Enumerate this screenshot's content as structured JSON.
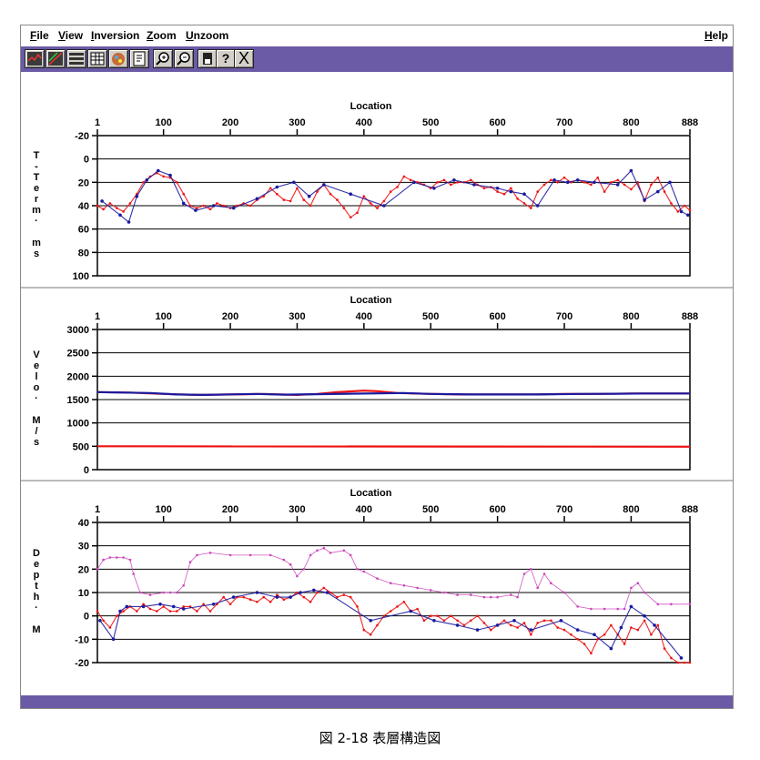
{
  "menu": {
    "file": {
      "accel": "F",
      "rest": "ile"
    },
    "view": {
      "accel": "V",
      "rest": "iew"
    },
    "inversion": {
      "accel": "I",
      "rest": "nversion"
    },
    "zoom": {
      "accel": "Z",
      "rest": "oom"
    },
    "unzoom": {
      "accel": "U",
      "rest": "nzoom"
    },
    "help": {
      "accel": "H",
      "rest": "elp"
    }
  },
  "toolbar": {
    "help_glyph": "?",
    "close_glyph": "X"
  },
  "caption": "図 2-18  表層構造図",
  "colors": {
    "accent": "#6b5aa6",
    "series_red": "#ee1111",
    "series_blue": "#1a1aa0",
    "series_magenta": "#cc44bb"
  },
  "chart_data": [
    {
      "type": "scatter",
      "xlabel": "Location",
      "ylabel_chars": [
        "T",
        "-",
        "T",
        "e",
        "r",
        "m",
        "·",
        "",
        "m",
        "s"
      ],
      "x_ticks": [
        1,
        100,
        200,
        300,
        400,
        500,
        600,
        700,
        800,
        888
      ],
      "xlim": [
        1,
        888
      ],
      "y_ticks": [
        -20,
        0,
        20,
        40,
        60,
        80,
        100
      ],
      "ylim": [
        -20,
        100
      ],
      "y_inverted": true,
      "grid": true,
      "series": [
        {
          "color": "#ee1111",
          "x": [
            1,
            10,
            20,
            30,
            40,
            50,
            60,
            70,
            80,
            90,
            100,
            110,
            120,
            130,
            140,
            150,
            160,
            170,
            180,
            190,
            200,
            210,
            220,
            230,
            240,
            250,
            260,
            270,
            280,
            290,
            300,
            310,
            320,
            330,
            340,
            350,
            360,
            370,
            380,
            390,
            400,
            410,
            420,
            430,
            440,
            450,
            460,
            470,
            480,
            490,
            500,
            510,
            520,
            530,
            540,
            550,
            560,
            570,
            580,
            590,
            600,
            610,
            620,
            630,
            640,
            650,
            660,
            670,
            680,
            690,
            700,
            710,
            720,
            730,
            740,
            750,
            760,
            770,
            780,
            790,
            800,
            810,
            820,
            830,
            840,
            850,
            860,
            870,
            880,
            888
          ],
          "y": [
            40,
            43,
            38,
            42,
            45,
            38,
            30,
            20,
            15,
            12,
            15,
            16,
            20,
            30,
            40,
            42,
            40,
            43,
            38,
            40,
            42,
            40,
            38,
            40,
            35,
            32,
            25,
            30,
            35,
            36,
            25,
            35,
            40,
            28,
            22,
            30,
            35,
            42,
            50,
            46,
            32,
            38,
            42,
            36,
            28,
            24,
            15,
            18,
            20,
            22,
            25,
            20,
            18,
            22,
            20,
            20,
            18,
            22,
            25,
            24,
            28,
            30,
            25,
            34,
            38,
            42,
            28,
            22,
            18,
            20,
            16,
            20,
            18,
            20,
            22,
            16,
            28,
            20,
            18,
            22,
            26,
            20,
            36,
            22,
            16,
            28,
            38,
            45,
            40,
            44
          ]
        },
        {
          "color": "#1a1aa0",
          "x": [
            8,
            35,
            48,
            60,
            75,
            92,
            110,
            130,
            148,
            175,
            205,
            240,
            270,
            295,
            318,
            340,
            380,
            430,
            475,
            505,
            535,
            565,
            600,
            620,
            640,
            660,
            685,
            705,
            720,
            745,
            780,
            800,
            820,
            840,
            858,
            875,
            885
          ],
          "y": [
            36,
            48,
            54,
            32,
            18,
            10,
            14,
            38,
            44,
            40,
            42,
            34,
            24,
            20,
            32,
            22,
            30,
            40,
            20,
            25,
            18,
            22,
            25,
            28,
            30,
            40,
            18,
            20,
            18,
            20,
            22,
            10,
            35,
            28,
            20,
            45,
            48
          ]
        }
      ]
    },
    {
      "type": "line",
      "xlabel": "Location",
      "ylabel_chars": [
        "V",
        "e",
        "l",
        "o",
        "·",
        "",
        "M",
        "/",
        "s"
      ],
      "x_ticks": [
        1,
        100,
        200,
        300,
        400,
        500,
        600,
        700,
        800,
        888
      ],
      "xlim": [
        1,
        888
      ],
      "y_ticks": [
        0,
        500,
        1000,
        1500,
        2000,
        2500,
        3000
      ],
      "ylim": [
        0,
        3000
      ],
      "grid": true,
      "series": [
        {
          "color": "#ee1111",
          "x": [
            1,
            50,
            100,
            150,
            200,
            250,
            300,
            330,
            360,
            400,
            420,
            450,
            500,
            550,
            600,
            650,
            700,
            750,
            800,
            850,
            888
          ],
          "y": [
            1660,
            1650,
            1620,
            1600,
            1610,
            1620,
            1600,
            1620,
            1660,
            1690,
            1680,
            1640,
            1620,
            1610,
            1610,
            1610,
            1620,
            1620,
            1630,
            1630,
            1630
          ]
        },
        {
          "color": "#1a1aa0",
          "x": [
            1,
            40,
            80,
            120,
            160,
            240,
            280,
            460,
            500,
            560,
            620,
            660,
            720,
            780,
            820,
            860,
            888
          ],
          "y": [
            1660,
            1650,
            1640,
            1610,
            1600,
            1620,
            1605,
            1640,
            1620,
            1610,
            1610,
            1610,
            1620,
            1625,
            1630,
            1630,
            1630
          ]
        },
        {
          "color": "#ee1111",
          "x": [
            1,
            888
          ],
          "y": [
            500,
            490
          ]
        }
      ]
    },
    {
      "type": "scatter",
      "xlabel": "Location",
      "ylabel_chars": [
        "D",
        "e",
        "p",
        "t",
        "h",
        "·",
        "",
        "M"
      ],
      "x_ticks": [
        1,
        100,
        200,
        300,
        400,
        500,
        600,
        700,
        800,
        888
      ],
      "xlim": [
        1,
        888
      ],
      "y_ticks": [
        40,
        30,
        20,
        10,
        0,
        -10,
        -20
      ],
      "ylim": [
        -20,
        40
      ],
      "grid": true,
      "series": [
        {
          "color": "#cc44bb",
          "x": [
            1,
            10,
            20,
            30,
            40,
            50,
            55,
            65,
            80,
            100,
            110,
            120,
            130,
            140,
            150,
            170,
            200,
            230,
            260,
            280,
            290,
            300,
            310,
            320,
            330,
            340,
            350,
            370,
            380,
            390,
            400,
            420,
            440,
            460,
            480,
            500,
            520,
            540,
            560,
            580,
            590,
            600,
            620,
            630,
            640,
            650,
            660,
            670,
            680,
            700,
            720,
            740,
            760,
            780,
            790,
            800,
            810,
            820,
            840,
            860,
            888
          ],
          "y": [
            20,
            24,
            25,
            25,
            25,
            24,
            18,
            10,
            9,
            10,
            10,
            10,
            13,
            23,
            26,
            27,
            26,
            26,
            26,
            24,
            22,
            17,
            20,
            26,
            28,
            29,
            27,
            28,
            26,
            20,
            19,
            16,
            14,
            13,
            12,
            11,
            10,
            9,
            9,
            8,
            8,
            8,
            9,
            8,
            18,
            20,
            12,
            18,
            14,
            10,
            4,
            3,
            3,
            3,
            3,
            12,
            14,
            10,
            5,
            5,
            5
          ]
        },
        {
          "color": "#ee1111",
          "x": [
            1,
            10,
            20,
            30,
            40,
            50,
            60,
            70,
            80,
            90,
            100,
            110,
            120,
            130,
            140,
            150,
            160,
            170,
            180,
            190,
            200,
            210,
            220,
            230,
            240,
            250,
            260,
            270,
            280,
            290,
            300,
            310,
            320,
            330,
            340,
            350,
            360,
            370,
            380,
            390,
            400,
            410,
            420,
            430,
            440,
            450,
            460,
            470,
            480,
            490,
            500,
            510,
            520,
            530,
            540,
            550,
            560,
            570,
            580,
            590,
            600,
            610,
            620,
            630,
            640,
            650,
            660,
            670,
            680,
            690,
            700,
            710,
            720,
            730,
            740,
            750,
            760,
            770,
            780,
            790,
            800,
            810,
            820,
            830,
            840,
            850,
            860,
            870,
            880,
            888
          ],
          "y": [
            2,
            -2,
            -5,
            0,
            2,
            4,
            2,
            5,
            3,
            2,
            4,
            2,
            2,
            4,
            4,
            2,
            5,
            2,
            5,
            8,
            5,
            8,
            8,
            7,
            6,
            8,
            6,
            9,
            7,
            8,
            10,
            8,
            6,
            10,
            12,
            10,
            8,
            9,
            8,
            4,
            -6,
            -8,
            -4,
            0,
            2,
            4,
            6,
            2,
            3,
            -2,
            0,
            0,
            -2,
            0,
            -2,
            -4,
            -2,
            0,
            -3,
            -6,
            -4,
            -2,
            -4,
            -5,
            -3,
            -8,
            -3,
            -2,
            -2,
            -5,
            -6,
            -8,
            -10,
            -12,
            -16,
            -10,
            -8,
            -4,
            -8,
            -12,
            -5,
            -6,
            -2,
            -8,
            -4,
            -14,
            -18,
            -20,
            -20,
            -20
          ]
        },
        {
          "color": "#1a1aa0",
          "x": [
            5,
            25,
            35,
            45,
            70,
            95,
            115,
            130,
            175,
            205,
            240,
            270,
            290,
            305,
            325,
            345,
            410,
            470,
            505,
            540,
            570,
            600,
            625,
            650,
            695,
            720,
            745,
            770,
            785,
            800,
            820,
            835,
            875
          ],
          "y": [
            -2,
            -10,
            2,
            4,
            4,
            5,
            4,
            3,
            5,
            8,
            10,
            8,
            8,
            10,
            11,
            10,
            -2,
            2,
            -2,
            -4,
            -6,
            -4,
            -2,
            -6,
            -2,
            -6,
            -8,
            -14,
            -5,
            4,
            0,
            -4,
            -18
          ]
        }
      ]
    }
  ]
}
